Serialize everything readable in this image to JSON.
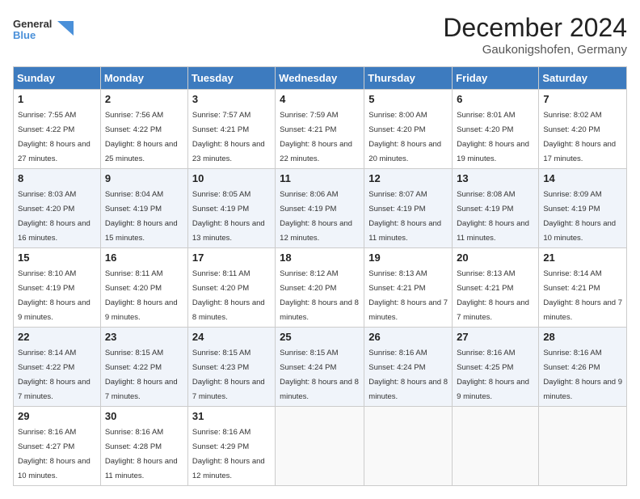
{
  "header": {
    "logo_general": "General",
    "logo_blue": "Blue",
    "title": "December 2024",
    "subtitle": "Gaukonigshofen, Germany"
  },
  "days_of_week": [
    "Sunday",
    "Monday",
    "Tuesday",
    "Wednesday",
    "Thursday",
    "Friday",
    "Saturday"
  ],
  "weeks": [
    [
      {
        "day": "1",
        "sunrise": "7:55 AM",
        "sunset": "4:22 PM",
        "daylight": "8 hours and 27 minutes."
      },
      {
        "day": "2",
        "sunrise": "7:56 AM",
        "sunset": "4:22 PM",
        "daylight": "8 hours and 25 minutes."
      },
      {
        "day": "3",
        "sunrise": "7:57 AM",
        "sunset": "4:21 PM",
        "daylight": "8 hours and 23 minutes."
      },
      {
        "day": "4",
        "sunrise": "7:59 AM",
        "sunset": "4:21 PM",
        "daylight": "8 hours and 22 minutes."
      },
      {
        "day": "5",
        "sunrise": "8:00 AM",
        "sunset": "4:20 PM",
        "daylight": "8 hours and 20 minutes."
      },
      {
        "day": "6",
        "sunrise": "8:01 AM",
        "sunset": "4:20 PM",
        "daylight": "8 hours and 19 minutes."
      },
      {
        "day": "7",
        "sunrise": "8:02 AM",
        "sunset": "4:20 PM",
        "daylight": "8 hours and 17 minutes."
      }
    ],
    [
      {
        "day": "8",
        "sunrise": "8:03 AM",
        "sunset": "4:20 PM",
        "daylight": "8 hours and 16 minutes."
      },
      {
        "day": "9",
        "sunrise": "8:04 AM",
        "sunset": "4:19 PM",
        "daylight": "8 hours and 15 minutes."
      },
      {
        "day": "10",
        "sunrise": "8:05 AM",
        "sunset": "4:19 PM",
        "daylight": "8 hours and 13 minutes."
      },
      {
        "day": "11",
        "sunrise": "8:06 AM",
        "sunset": "4:19 PM",
        "daylight": "8 hours and 12 minutes."
      },
      {
        "day": "12",
        "sunrise": "8:07 AM",
        "sunset": "4:19 PM",
        "daylight": "8 hours and 11 minutes."
      },
      {
        "day": "13",
        "sunrise": "8:08 AM",
        "sunset": "4:19 PM",
        "daylight": "8 hours and 11 minutes."
      },
      {
        "day": "14",
        "sunrise": "8:09 AM",
        "sunset": "4:19 PM",
        "daylight": "8 hours and 10 minutes."
      }
    ],
    [
      {
        "day": "15",
        "sunrise": "8:10 AM",
        "sunset": "4:19 PM",
        "daylight": "8 hours and 9 minutes."
      },
      {
        "day": "16",
        "sunrise": "8:11 AM",
        "sunset": "4:20 PM",
        "daylight": "8 hours and 9 minutes."
      },
      {
        "day": "17",
        "sunrise": "8:11 AM",
        "sunset": "4:20 PM",
        "daylight": "8 hours and 8 minutes."
      },
      {
        "day": "18",
        "sunrise": "8:12 AM",
        "sunset": "4:20 PM",
        "daylight": "8 hours and 8 minutes."
      },
      {
        "day": "19",
        "sunrise": "8:13 AM",
        "sunset": "4:21 PM",
        "daylight": "8 hours and 7 minutes."
      },
      {
        "day": "20",
        "sunrise": "8:13 AM",
        "sunset": "4:21 PM",
        "daylight": "8 hours and 7 minutes."
      },
      {
        "day": "21",
        "sunrise": "8:14 AM",
        "sunset": "4:21 PM",
        "daylight": "8 hours and 7 minutes."
      }
    ],
    [
      {
        "day": "22",
        "sunrise": "8:14 AM",
        "sunset": "4:22 PM",
        "daylight": "8 hours and 7 minutes."
      },
      {
        "day": "23",
        "sunrise": "8:15 AM",
        "sunset": "4:22 PM",
        "daylight": "8 hours and 7 minutes."
      },
      {
        "day": "24",
        "sunrise": "8:15 AM",
        "sunset": "4:23 PM",
        "daylight": "8 hours and 7 minutes."
      },
      {
        "day": "25",
        "sunrise": "8:15 AM",
        "sunset": "4:24 PM",
        "daylight": "8 hours and 8 minutes."
      },
      {
        "day": "26",
        "sunrise": "8:16 AM",
        "sunset": "4:24 PM",
        "daylight": "8 hours and 8 minutes."
      },
      {
        "day": "27",
        "sunrise": "8:16 AM",
        "sunset": "4:25 PM",
        "daylight": "8 hours and 9 minutes."
      },
      {
        "day": "28",
        "sunrise": "8:16 AM",
        "sunset": "4:26 PM",
        "daylight": "8 hours and 9 minutes."
      }
    ],
    [
      {
        "day": "29",
        "sunrise": "8:16 AM",
        "sunset": "4:27 PM",
        "daylight": "8 hours and 10 minutes."
      },
      {
        "day": "30",
        "sunrise": "8:16 AM",
        "sunset": "4:28 PM",
        "daylight": "8 hours and 11 minutes."
      },
      {
        "day": "31",
        "sunrise": "8:16 AM",
        "sunset": "4:29 PM",
        "daylight": "8 hours and 12 minutes."
      },
      null,
      null,
      null,
      null
    ]
  ],
  "labels": {
    "sunrise": "Sunrise:",
    "sunset": "Sunset:",
    "daylight": "Daylight:"
  }
}
